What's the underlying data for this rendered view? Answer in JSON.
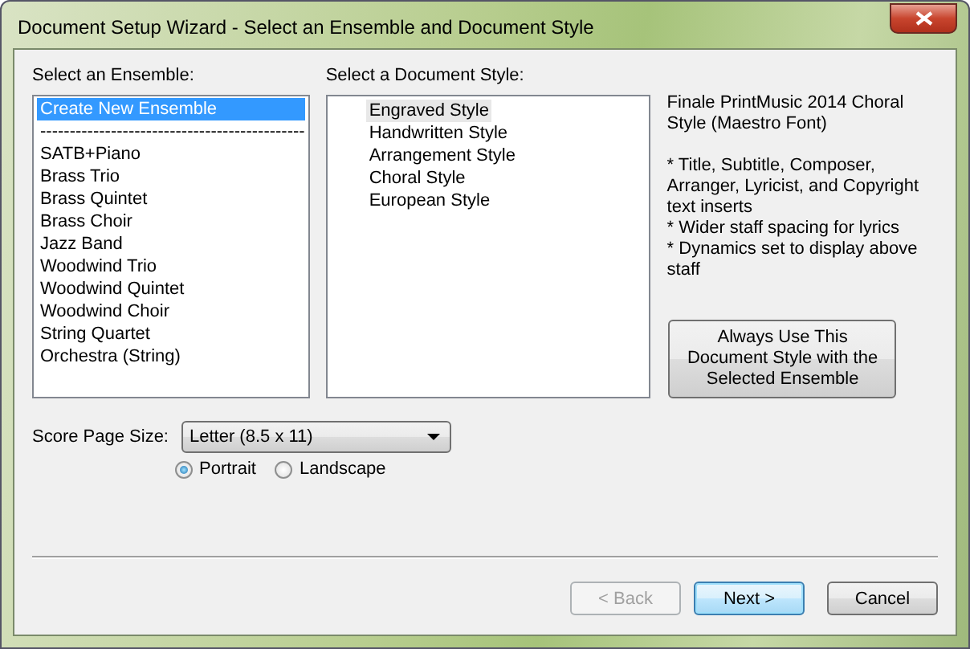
{
  "window": {
    "title": "Document Setup Wizard - Select an Ensemble and Document Style"
  },
  "ensemble": {
    "label": "Select an Ensemble:",
    "items": [
      {
        "text": "Create New Ensemble",
        "selected": true
      },
      {
        "text": "---------------------------------------------",
        "selected": false
      },
      {
        "text": "SATB+Piano",
        "selected": false
      },
      {
        "text": "Brass Trio",
        "selected": false
      },
      {
        "text": "Brass Quintet",
        "selected": false
      },
      {
        "text": "Brass Choir",
        "selected": false
      },
      {
        "text": "Jazz Band",
        "selected": false
      },
      {
        "text": "Woodwind Trio",
        "selected": false
      },
      {
        "text": "Woodwind Quintet",
        "selected": false
      },
      {
        "text": "Woodwind Choir",
        "selected": false
      },
      {
        "text": "String Quartet",
        "selected": false
      },
      {
        "text": "Orchestra (String)",
        "selected": false
      }
    ]
  },
  "style": {
    "label": "Select a Document Style:",
    "items": [
      {
        "text": "Engraved Style",
        "selected": true
      },
      {
        "text": "Handwritten Style",
        "selected": false
      },
      {
        "text": "Arrangement Style",
        "selected": false
      },
      {
        "text": "Choral Style",
        "selected": false
      },
      {
        "text": "European Style",
        "selected": false
      }
    ]
  },
  "description": {
    "heading": "Finale PrintMusic 2014 Choral Style (Maestro Font)",
    "bullets": [
      "* Title, Subtitle, Composer, Arranger, Lyricist, and Copyright text inserts",
      "* Wider staff spacing for lyrics",
      "* Dynamics set to display above staff"
    ]
  },
  "always_button": "Always Use This Document Style with the Selected Ensemble",
  "page_size": {
    "label": "Score Page Size:",
    "value": "Letter (8.5 x 11)"
  },
  "orientation": [
    {
      "label": "Portrait",
      "selected": true
    },
    {
      "label": "Landscape",
      "selected": false
    }
  ],
  "buttons": [
    {
      "label": "< Back",
      "disabled": true,
      "default": false
    },
    {
      "label": "Next >",
      "disabled": false,
      "default": true
    },
    {
      "label": "Cancel",
      "disabled": false,
      "default": false
    }
  ]
}
